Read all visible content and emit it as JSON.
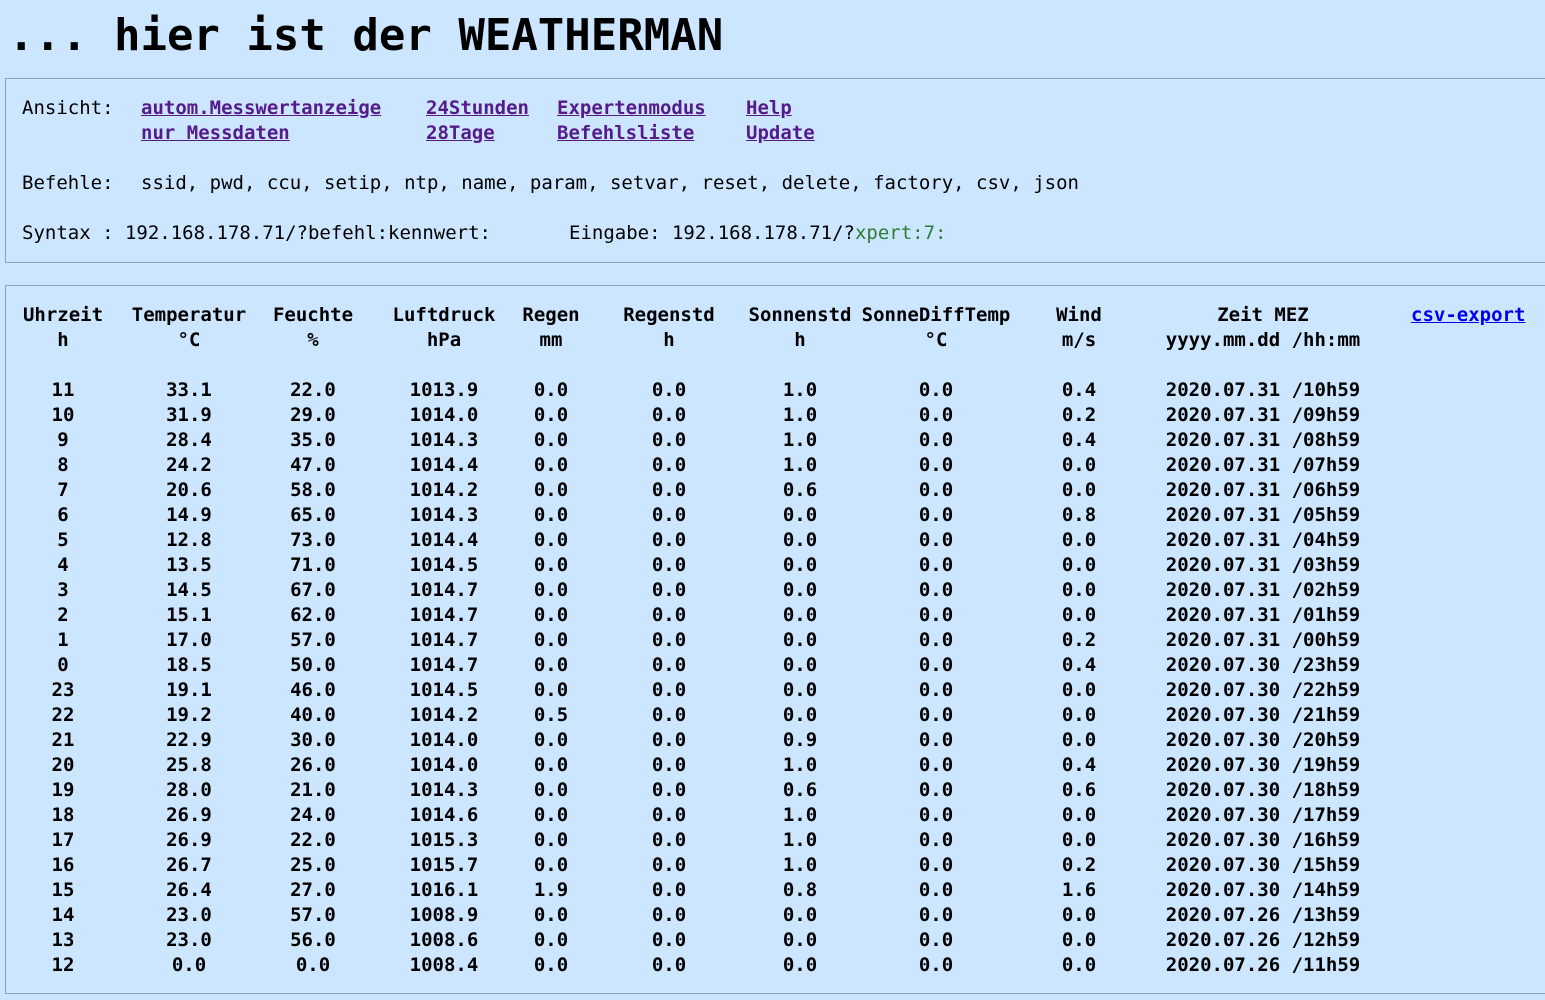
{
  "title": "... hier ist der WEATHERMAN",
  "view": {
    "label": "Ansicht:",
    "links": {
      "autom": "autom.Messwertanzeige",
      "nur": "nur Messdaten",
      "h24": "24Stunden",
      "d28": "28Tage",
      "expert": "Expertenmodus",
      "befehlsliste": "Befehlsliste",
      "help": "Help",
      "update": "Update"
    }
  },
  "commands": {
    "label": "Befehle:",
    "list": "ssid, pwd, ccu, setip, ntp, name, param, setvar, reset, delete, factory, csv, json"
  },
  "syntax": {
    "label": "Syntax : 192.168.178.71/?befehl:kennwert:",
    "input_label": "Eingabe: 192.168.178.71/?",
    "input_value": "xpert:7:"
  },
  "table": {
    "csv_link": "csv-export",
    "headers": [
      {
        "name": "Uhrzeit",
        "unit": "h"
      },
      {
        "name": "Temperatur",
        "unit": "°C"
      },
      {
        "name": "Feuchte",
        "unit": "%"
      },
      {
        "name": "Luftdruck",
        "unit": "hPa"
      },
      {
        "name": "Regen",
        "unit": "mm"
      },
      {
        "name": "Regenstd",
        "unit": "h"
      },
      {
        "name": "Sonnenstd",
        "unit": "h"
      },
      {
        "name": "SonneDiffTemp",
        "unit": "°C"
      },
      {
        "name": "Wind",
        "unit": "m/s"
      },
      {
        "name": "Zeit MEZ",
        "unit": "yyyy.mm.dd /hh:mm"
      }
    ],
    "rows": [
      [
        "11",
        "33.1",
        "22.0",
        "1013.9",
        "0.0",
        "0.0",
        "1.0",
        "0.0",
        "0.4",
        "2020.07.31 /10h59"
      ],
      [
        "10",
        "31.9",
        "29.0",
        "1014.0",
        "0.0",
        "0.0",
        "1.0",
        "0.0",
        "0.2",
        "2020.07.31 /09h59"
      ],
      [
        "9",
        "28.4",
        "35.0",
        "1014.3",
        "0.0",
        "0.0",
        "1.0",
        "0.0",
        "0.4",
        "2020.07.31 /08h59"
      ],
      [
        "8",
        "24.2",
        "47.0",
        "1014.4",
        "0.0",
        "0.0",
        "1.0",
        "0.0",
        "0.0",
        "2020.07.31 /07h59"
      ],
      [
        "7",
        "20.6",
        "58.0",
        "1014.2",
        "0.0",
        "0.0",
        "0.6",
        "0.0",
        "0.0",
        "2020.07.31 /06h59"
      ],
      [
        "6",
        "14.9",
        "65.0",
        "1014.3",
        "0.0",
        "0.0",
        "0.0",
        "0.0",
        "0.8",
        "2020.07.31 /05h59"
      ],
      [
        "5",
        "12.8",
        "73.0",
        "1014.4",
        "0.0",
        "0.0",
        "0.0",
        "0.0",
        "0.0",
        "2020.07.31 /04h59"
      ],
      [
        "4",
        "13.5",
        "71.0",
        "1014.5",
        "0.0",
        "0.0",
        "0.0",
        "0.0",
        "0.0",
        "2020.07.31 /03h59"
      ],
      [
        "3",
        "14.5",
        "67.0",
        "1014.7",
        "0.0",
        "0.0",
        "0.0",
        "0.0",
        "0.0",
        "2020.07.31 /02h59"
      ],
      [
        "2",
        "15.1",
        "62.0",
        "1014.7",
        "0.0",
        "0.0",
        "0.0",
        "0.0",
        "0.0",
        "2020.07.31 /01h59"
      ],
      [
        "1",
        "17.0",
        "57.0",
        "1014.7",
        "0.0",
        "0.0",
        "0.0",
        "0.0",
        "0.2",
        "2020.07.31 /00h59"
      ],
      [
        "0",
        "18.5",
        "50.0",
        "1014.7",
        "0.0",
        "0.0",
        "0.0",
        "0.0",
        "0.4",
        "2020.07.30 /23h59"
      ],
      [
        "23",
        "19.1",
        "46.0",
        "1014.5",
        "0.0",
        "0.0",
        "0.0",
        "0.0",
        "0.0",
        "2020.07.30 /22h59"
      ],
      [
        "22",
        "19.2",
        "40.0",
        "1014.2",
        "0.5",
        "0.0",
        "0.0",
        "0.0",
        "0.0",
        "2020.07.30 /21h59"
      ],
      [
        "21",
        "22.9",
        "30.0",
        "1014.0",
        "0.0",
        "0.0",
        "0.9",
        "0.0",
        "0.0",
        "2020.07.30 /20h59"
      ],
      [
        "20",
        "25.8",
        "26.0",
        "1014.0",
        "0.0",
        "0.0",
        "1.0",
        "0.0",
        "0.4",
        "2020.07.30 /19h59"
      ],
      [
        "19",
        "28.0",
        "21.0",
        "1014.3",
        "0.0",
        "0.0",
        "0.6",
        "0.0",
        "0.6",
        "2020.07.30 /18h59"
      ],
      [
        "18",
        "26.9",
        "24.0",
        "1014.6",
        "0.0",
        "0.0",
        "1.0",
        "0.0",
        "0.0",
        "2020.07.30 /17h59"
      ],
      [
        "17",
        "26.9",
        "22.0",
        "1015.3",
        "0.0",
        "0.0",
        "1.0",
        "0.0",
        "0.0",
        "2020.07.30 /16h59"
      ],
      [
        "16",
        "26.7",
        "25.0",
        "1015.7",
        "0.0",
        "0.0",
        "1.0",
        "0.0",
        "0.2",
        "2020.07.30 /15h59"
      ],
      [
        "15",
        "26.4",
        "27.0",
        "1016.1",
        "1.9",
        "0.0",
        "0.8",
        "0.0",
        "1.6",
        "2020.07.30 /14h59"
      ],
      [
        "14",
        "23.0",
        "57.0",
        "1008.9",
        "0.0",
        "0.0",
        "0.0",
        "0.0",
        "0.0",
        "2020.07.26 /13h59"
      ],
      [
        "13",
        "23.0",
        "56.0",
        "1008.6",
        "0.0",
        "0.0",
        "0.0",
        "0.0",
        "0.0",
        "2020.07.26 /12h59"
      ],
      [
        "12",
        "0.0",
        "0.0",
        "1008.4",
        "0.0",
        "0.0",
        "0.0",
        "0.0",
        "0.0",
        "2020.07.26 /11h59"
      ]
    ]
  }
}
